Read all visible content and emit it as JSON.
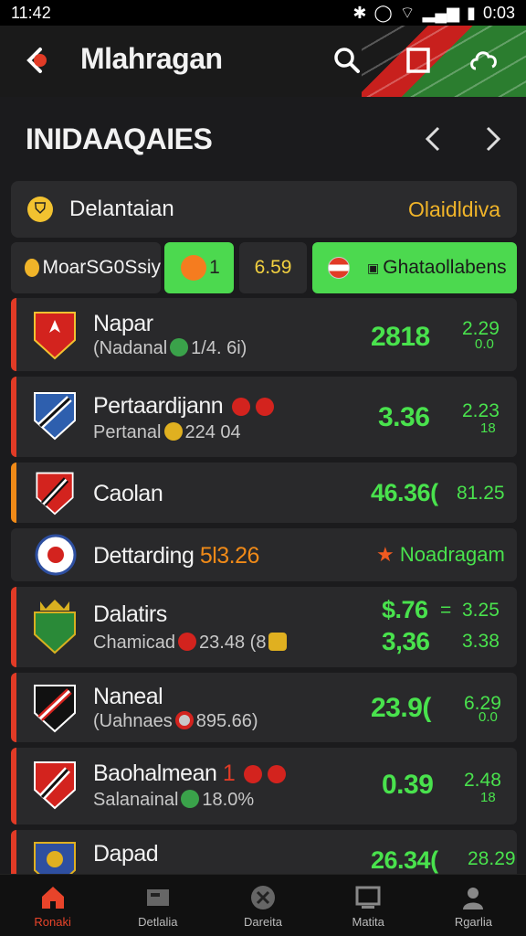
{
  "status": {
    "time": "11:42",
    "right": "0:03"
  },
  "header": {
    "title": "Mlahragan"
  },
  "section": {
    "title": "INIDAAQAIES"
  },
  "banner": {
    "label": "Delantaian",
    "value": "Olaidldiva"
  },
  "filters": [
    {
      "label": "MoarSG0Ssiy"
    },
    {
      "label": "1"
    },
    {
      "label": "6.59"
    },
    {
      "label": "Ghataollabens"
    }
  ],
  "matches": [
    {
      "name": "Napar",
      "sub": "(Nadanal",
      "sub_value": "1/4. 6i)",
      "odds": "2818",
      "odds2": "2.29",
      "odds3": "0.0"
    },
    {
      "name": "Pertaardijann",
      "sub": "Pertanal",
      "sub_value": "224 04",
      "odds": "3.36",
      "odds2": "2.23",
      "odds3": "18"
    },
    {
      "name": "Caolan",
      "odds": "46.36(",
      "odds2": "81.25"
    },
    {
      "name": "Dettarding",
      "name_value": "5l3.26",
      "right_label": "Noadragam"
    },
    {
      "name": "Dalatirs",
      "sub": "Chamicad",
      "sub_value": "23.48 (8",
      "odds": "$.76",
      "odds_sep": "=",
      "odds2": "3.25",
      "odds_b": "3,36",
      "odds2_b": "3.38"
    },
    {
      "name": "Naneal",
      "sub": "(Uahnaes",
      "sub_value": "895.66)",
      "odds": "23.9(",
      "odds2": "6.29",
      "odds3": "0.0"
    },
    {
      "name": "Baohalmean",
      "name_value": "1",
      "sub": "Salanainal",
      "sub_value": "18.0%",
      "odds": "0.39",
      "odds2": "2.48",
      "odds3": "18"
    },
    {
      "name": "Dapad",
      "odds": "26.34(",
      "odds2": "28.29"
    }
  ],
  "tabs": [
    {
      "label": "Ronaki"
    },
    {
      "label": "Detlalia"
    },
    {
      "label": "Dareita"
    },
    {
      "label": "Matita"
    },
    {
      "label": "Rgarlia"
    }
  ],
  "colors": {
    "accent_green": "#49e24d",
    "accent_red": "#e13b26",
    "accent_gold": "#f0b429"
  }
}
